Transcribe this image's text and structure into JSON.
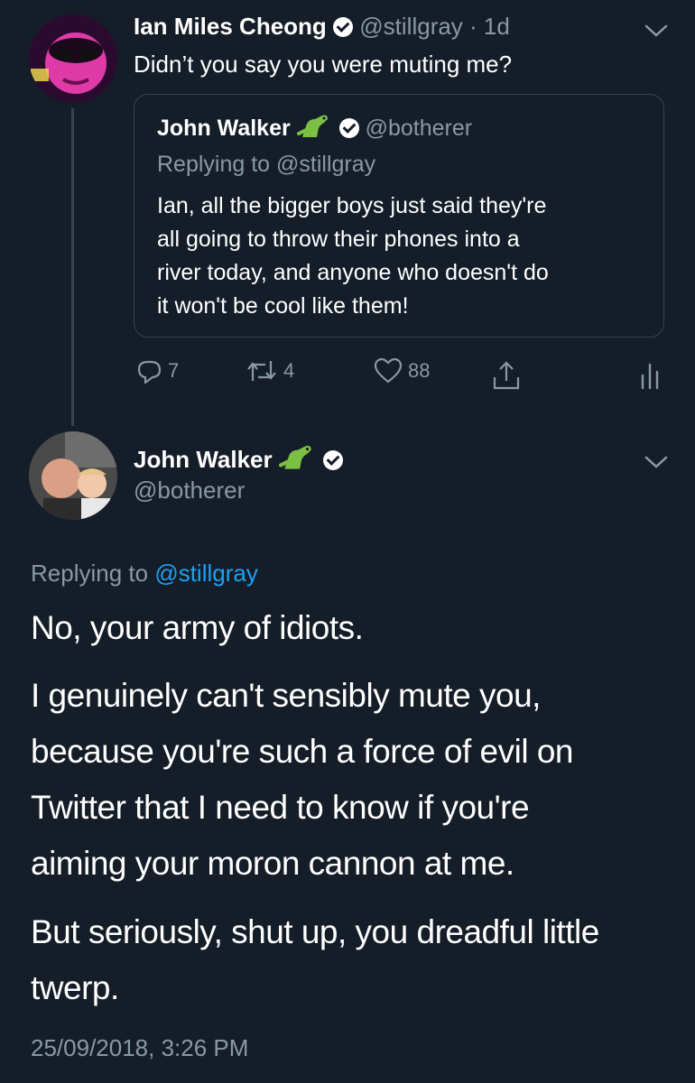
{
  "tweet1": {
    "author_name": "Ian Miles Cheong",
    "handle": "@stillgray",
    "age": "· 1d",
    "text": "Didn’t you say you were muting me?",
    "quoted": {
      "author_name": "John Walker",
      "handle": "@botherer",
      "replying_prefix": "Replying to",
      "replying_handle": "@stillgray",
      "text_lines": [
        "Ian, all the bigger boys just said they're",
        "all going to throw their phones into a",
        "river today, and anyone who doesn't do",
        "it won't be cool like them!"
      ]
    },
    "actions": {
      "replies": "7",
      "retweets": "4",
      "likes": "88"
    }
  },
  "tweet2": {
    "author_name": "John Walker",
    "handle": "@botherer",
    "replying_prefix": "Replying to",
    "replying_handle": "@stillgray",
    "paragraph1": "No, your army of idiots.",
    "paragraph2_lines": [
      "I genuinely can't sensibly mute you,",
      "because you're such a force of evil on",
      "Twitter that I need to know if you're",
      "aiming your moron cannon at me."
    ],
    "paragraph3_lines": [
      "But seriously, shut up, you dreadful little",
      "twerp."
    ],
    "timestamp": "25/09/2018, 3:26 PM"
  },
  "colors": {
    "background": "#151d28",
    "muted": "#8899a6",
    "link": "#1da1f2",
    "border": "#38444d"
  }
}
